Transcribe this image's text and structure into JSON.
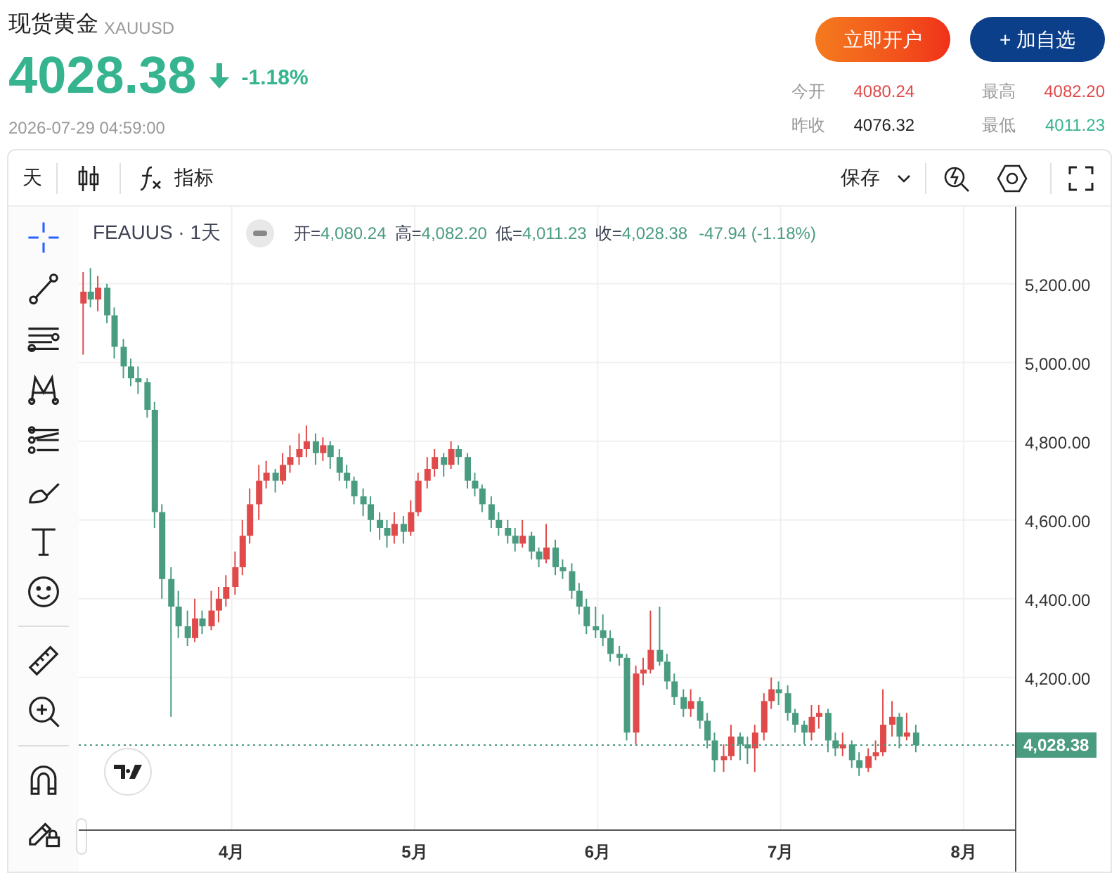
{
  "instrument": {
    "name": "现货黄金",
    "symbol": "XAUUSD",
    "price": "4028.38",
    "change_pct": "-1.18%",
    "falling": true,
    "timestamp": "2026-07-29 04:59:00"
  },
  "buttons": [
    {
      "label": "立即开户",
      "kind": "primary"
    },
    {
      "label": "+ 加自选",
      "kind": "secondary"
    }
  ],
  "stats": [
    {
      "label": "今开",
      "value": "4080.24",
      "color": "#e04a4a"
    },
    {
      "label": "最高",
      "value": "4082.20",
      "color": "#e04a4a"
    },
    {
      "label": "昨收",
      "value": "4076.32",
      "color": "#222222"
    },
    {
      "label": "最低",
      "value": "4011.23",
      "color": "#35b48f"
    }
  ],
  "toolbar": {
    "interval": "天",
    "indicators": "指标",
    "save": "保存"
  },
  "legend": {
    "symbol": "FEAUUS",
    "separator": "·",
    "interval": "1天",
    "values": [
      {
        "label": "开=",
        "value": "4,080.24"
      },
      {
        "label": "高=",
        "value": "4,082.20"
      },
      {
        "label": "低=",
        "value": "4,011.23"
      },
      {
        "label": "收=",
        "value": "4,028.38"
      }
    ],
    "change": "-47.94 (-1.18%)"
  },
  "chart_data": {
    "type": "candlestick",
    "x": [
      3.19,
      3.23,
      3.27,
      3.32,
      3.36,
      3.41,
      3.45,
      3.49,
      3.54,
      3.58,
      3.62,
      3.67,
      3.71,
      3.76,
      3.8,
      3.84,
      3.89,
      3.93,
      3.97,
      4.02,
      4.06,
      4.1,
      4.15,
      4.19,
      4.24,
      4.28,
      4.32,
      4.37,
      4.41,
      4.46,
      4.5,
      4.54,
      4.59,
      4.63,
      4.67,
      4.72,
      4.76,
      4.81,
      4.85,
      4.89,
      4.94,
      4.98,
      5.02,
      5.07,
      5.11,
      5.16,
      5.2,
      5.24,
      5.29,
      5.33,
      5.37,
      5.42,
      5.46,
      5.51,
      5.55,
      5.59,
      5.64,
      5.68,
      5.72,
      5.77,
      5.81,
      5.86,
      5.9,
      5.94,
      5.99,
      6.03,
      6.07,
      6.12,
      6.16,
      6.21,
      6.25,
      6.29,
      6.34,
      6.38,
      6.42,
      6.47,
      6.51,
      6.56,
      6.6,
      6.64,
      6.69,
      6.73,
      6.78,
      6.82,
      6.86,
      6.91,
      6.95,
      6.99,
      7.04,
      7.08,
      7.13,
      7.17,
      7.21,
      7.26,
      7.3,
      7.34,
      7.39,
      7.43,
      7.48,
      7.52,
      7.56,
      7.61,
      7.65,
      7.69,
      7.74
    ],
    "ohlc": [
      [
        5150,
        5230,
        5020,
        5180
      ],
      [
        5180,
        5240,
        5140,
        5160
      ],
      [
        5160,
        5220,
        5130,
        5190
      ],
      [
        5190,
        5200,
        5100,
        5120
      ],
      [
        5120,
        5140,
        5010,
        5040
      ],
      [
        5040,
        5060,
        4960,
        4990
      ],
      [
        4990,
        5010,
        4940,
        4960
      ],
      [
        4960,
        4990,
        4920,
        4950
      ],
      [
        4950,
        4960,
        4860,
        4880
      ],
      [
        4880,
        4900,
        4580,
        4620
      ],
      [
        4620,
        4640,
        4400,
        4450
      ],
      [
        4450,
        4480,
        4100,
        4380
      ],
      [
        4380,
        4420,
        4300,
        4330
      ],
      [
        4330,
        4370,
        4280,
        4300
      ],
      [
        4300,
        4400,
        4290,
        4350
      ],
      [
        4350,
        4370,
        4310,
        4330
      ],
      [
        4330,
        4420,
        4320,
        4370
      ],
      [
        4370,
        4430,
        4340,
        4400
      ],
      [
        4400,
        4460,
        4380,
        4430
      ],
      [
        4430,
        4520,
        4410,
        4480
      ],
      [
        4480,
        4600,
        4460,
        4560
      ],
      [
        4560,
        4680,
        4540,
        4640
      ],
      [
        4640,
        4740,
        4600,
        4700
      ],
      [
        4700,
        4750,
        4680,
        4720
      ],
      [
        4720,
        4730,
        4670,
        4700
      ],
      [
        4700,
        4770,
        4690,
        4740
      ],
      [
        4740,
        4790,
        4720,
        4760
      ],
      [
        4760,
        4820,
        4740,
        4780
      ],
      [
        4780,
        4840,
        4760,
        4800
      ],
      [
        4800,
        4820,
        4740,
        4770
      ],
      [
        4770,
        4810,
        4750,
        4790
      ],
      [
        4790,
        4800,
        4730,
        4760
      ],
      [
        4760,
        4780,
        4700,
        4720
      ],
      [
        4720,
        4740,
        4680,
        4700
      ],
      [
        4700,
        4710,
        4640,
        4660
      ],
      [
        4660,
        4680,
        4610,
        4640
      ],
      [
        4640,
        4660,
        4570,
        4600
      ],
      [
        4600,
        4620,
        4550,
        4580
      ],
      [
        4580,
        4600,
        4530,
        4560
      ],
      [
        4560,
        4620,
        4540,
        4590
      ],
      [
        4590,
        4610,
        4540,
        4570
      ],
      [
        4570,
        4650,
        4560,
        4620
      ],
      [
        4620,
        4720,
        4610,
        4700
      ],
      [
        4700,
        4760,
        4680,
        4730
      ],
      [
        4730,
        4780,
        4710,
        4760
      ],
      [
        4760,
        4770,
        4710,
        4740
      ],
      [
        4740,
        4800,
        4730,
        4780
      ],
      [
        4780,
        4790,
        4740,
        4760
      ],
      [
        4760,
        4770,
        4680,
        4700
      ],
      [
        4700,
        4720,
        4660,
        4680
      ],
      [
        4680,
        4690,
        4620,
        4640
      ],
      [
        4640,
        4660,
        4580,
        4600
      ],
      [
        4600,
        4620,
        4560,
        4580
      ],
      [
        4580,
        4600,
        4540,
        4560
      ],
      [
        4560,
        4580,
        4520,
        4540
      ],
      [
        4540,
        4600,
        4530,
        4560
      ],
      [
        4560,
        4570,
        4500,
        4520
      ],
      [
        4520,
        4530,
        4480,
        4500
      ],
      [
        4500,
        4590,
        4490,
        4530
      ],
      [
        4530,
        4550,
        4460,
        4480
      ],
      [
        4480,
        4500,
        4450,
        4470
      ],
      [
        4470,
        4490,
        4400,
        4420
      ],
      [
        4420,
        4440,
        4360,
        4380
      ],
      [
        4380,
        4400,
        4310,
        4330
      ],
      [
        4330,
        4380,
        4300,
        4320
      ],
      [
        4320,
        4360,
        4280,
        4300
      ],
      [
        4300,
        4320,
        4240,
        4260
      ],
      [
        4260,
        4280,
        4230,
        4250
      ],
      [
        4250,
        4260,
        4040,
        4060
      ],
      [
        4060,
        4230,
        4030,
        4210
      ],
      [
        4210,
        4250,
        4180,
        4220
      ],
      [
        4220,
        4370,
        4210,
        4270
      ],
      [
        4270,
        4380,
        4230,
        4240
      ],
      [
        4240,
        4260,
        4170,
        4190
      ],
      [
        4190,
        4210,
        4130,
        4150
      ],
      [
        4150,
        4170,
        4100,
        4120
      ],
      [
        4120,
        4170,
        4100,
        4140
      ],
      [
        4140,
        4150,
        4070,
        4090
      ],
      [
        4090,
        4110,
        4020,
        4040
      ],
      [
        4040,
        4060,
        3960,
        3990
      ],
      [
        3990,
        4030,
        3960,
        4000
      ],
      [
        4000,
        4080,
        3990,
        4050
      ],
      [
        4050,
        4060,
        3990,
        4030
      ],
      [
        4030,
        4050,
        3980,
        4020
      ],
      [
        4020,
        4080,
        3960,
        4060
      ],
      [
        4060,
        4160,
        4040,
        4140
      ],
      [
        4140,
        4200,
        4120,
        4170
      ],
      [
        4170,
        4190,
        4130,
        4160
      ],
      [
        4160,
        4180,
        4090,
        4110
      ],
      [
        4110,
        4120,
        4060,
        4080
      ],
      [
        4080,
        4090,
        4030,
        4060
      ],
      [
        4060,
        4130,
        4040,
        4100
      ],
      [
        4100,
        4130,
        4070,
        4110
      ],
      [
        4110,
        4120,
        4010,
        4040
      ],
      [
        4040,
        4060,
        4000,
        4020
      ],
      [
        4020,
        4060,
        4000,
        4030
      ],
      [
        4030,
        4040,
        3970,
        3990
      ],
      [
        3990,
        4010,
        3950,
        3970
      ],
      [
        3970,
        4020,
        3960,
        4000
      ],
      [
        4000,
        4040,
        3990,
        4010
      ],
      [
        4010,
        4170,
        4000,
        4080
      ],
      [
        4080,
        4140,
        4050,
        4100
      ],
      [
        4100,
        4110,
        4020,
        4050
      ],
      [
        4050,
        4110,
        4040,
        4060
      ],
      [
        4060,
        4080,
        4010,
        4028
      ]
    ],
    "grid": true,
    "ref_lines": [
      {
        "axis": "y",
        "value": 4028.38,
        "label": "4,028.38"
      }
    ],
    "xlim": [
      3.164,
      8.28
    ],
    "ylim": [
      3814,
      5396
    ],
    "xticks": [
      {
        "value": 4,
        "label": "4月"
      },
      {
        "value": 5,
        "label": "5月"
      },
      {
        "value": 6,
        "label": "6月"
      },
      {
        "value": 7,
        "label": "7月"
      },
      {
        "value": 8,
        "label": "8月"
      }
    ],
    "yticks": [
      {
        "value": 5200,
        "label": "5,200.00"
      },
      {
        "value": 5000,
        "label": "5,000.00"
      },
      {
        "value": 4800,
        "label": "4,800.00"
      },
      {
        "value": 4600,
        "label": "4,600.00"
      },
      {
        "value": 4400,
        "label": "4,400.00"
      },
      {
        "value": 4200,
        "label": "4,200.00"
      }
    ]
  },
  "side_tools": [
    {
      "kind": "crosshair",
      "selected": true
    },
    {
      "kind": "trendline",
      "selected": false
    },
    {
      "kind": "hlines",
      "selected": false
    },
    {
      "kind": "pattern",
      "selected": false
    },
    {
      "kind": "fib",
      "selected": false
    },
    {
      "kind": "brush",
      "selected": false
    },
    {
      "kind": "text",
      "selected": false
    },
    {
      "kind": "emoji",
      "selected": false
    },
    {
      "kind": "divider"
    },
    {
      "kind": "ruler",
      "selected": false
    },
    {
      "kind": "zoom",
      "selected": false
    },
    {
      "kind": "divider"
    },
    {
      "kind": "magnet",
      "selected": false
    },
    {
      "kind": "lock",
      "selected": false
    }
  ]
}
